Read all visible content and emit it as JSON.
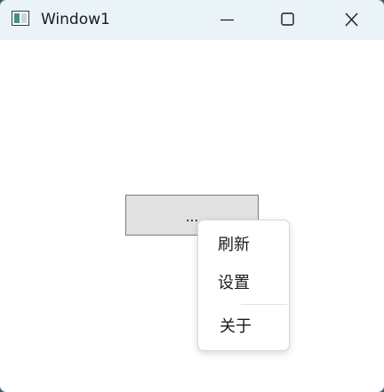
{
  "window": {
    "title": "Window1",
    "icon": "window-app-icon",
    "controls": {
      "minimize_icon": "minimize-icon",
      "maximize_icon": "maximize-icon",
      "close_icon": "close-icon"
    }
  },
  "main": {
    "button_label": "..."
  },
  "context_menu": {
    "items": [
      {
        "label": "刷新"
      },
      {
        "label": "设置"
      },
      {
        "label": "关于"
      }
    ]
  },
  "colors": {
    "titlebar_bg": "#e9f3f8",
    "button_bg": "#e1e1e1",
    "button_border": "#7a7a7a",
    "desktop_bg": "#2f5d5f"
  }
}
